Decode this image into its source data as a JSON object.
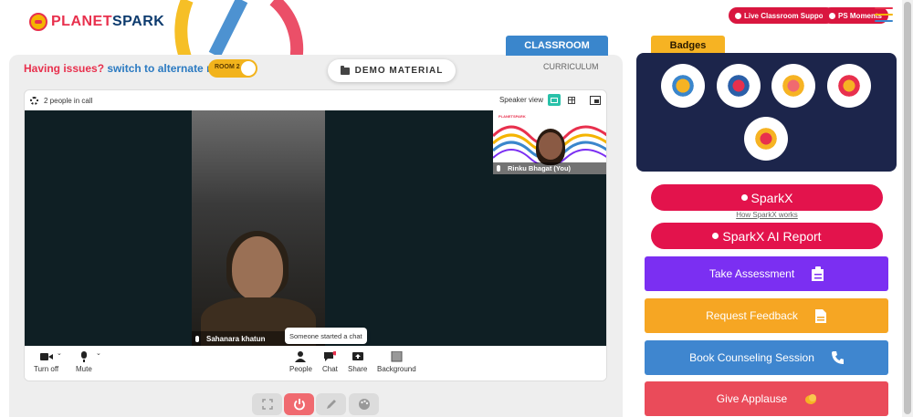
{
  "brand": {
    "logo_text_1": "PLANET",
    "logo_text_2": "SPARK"
  },
  "header": {
    "live_support": "Live Classroom Support",
    "ps_moments": "PS Moments"
  },
  "colors": {
    "accent_red": "#e3134c",
    "accent_blue": "#3a86cc",
    "accent_yellow": "#f6b323",
    "badges_bg": "#1c254b",
    "purple": "#7b2ff2",
    "orange": "#f6a623",
    "blue": "#3f86cf",
    "red": "#ea4b5a"
  },
  "classroom": {
    "issues_text": "Having issues?",
    "alternate_text": "switch to alternate room",
    "room_toggle": "ROOM 2",
    "demo_material": "DEMO MATERIAL",
    "tab_classroom": "CLASSROOM",
    "tab_curriculum": "CURRICULUM"
  },
  "call": {
    "people_count": "2 people in call",
    "speaker_view": "Speaker view",
    "main_participant": "Sahanara khatun",
    "self_participant": "Rinku Bhagat (You)",
    "self_brand": "PLANETSPARK",
    "toast": "Someone started a chat",
    "toolbar": {
      "turn_off": "Turn off",
      "mute": "Mute",
      "people": "People",
      "chat": "Chat",
      "share": "Share",
      "background": "Background"
    }
  },
  "sidebar": {
    "badges_title": "Badges",
    "sparkx": "SparkX",
    "how_sparkx": "How SparkX works",
    "sparkx_report": "SparkX AI Report",
    "actions": [
      {
        "label": "Take Assessment",
        "icon": "clipboard-icon"
      },
      {
        "label": "Request Feedback",
        "icon": "document-icon"
      },
      {
        "label": "Book Counseling Session",
        "icon": "phone-icon"
      },
      {
        "label": "Give Applause",
        "icon": "clap-icon"
      }
    ]
  }
}
